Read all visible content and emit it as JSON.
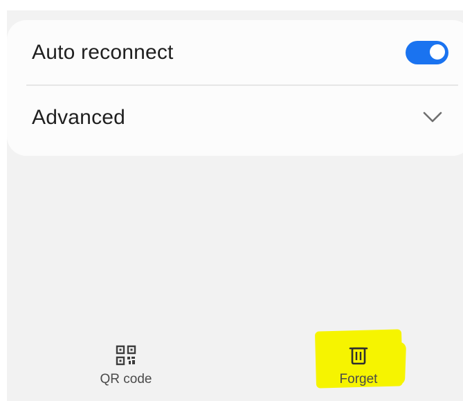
{
  "settings": {
    "auto_reconnect_label": "Auto reconnect",
    "auto_reconnect_enabled": true,
    "advanced_label": "Advanced"
  },
  "bottom_bar": {
    "qr_code_label": "QR code",
    "forget_label": "Forget"
  },
  "icons": {
    "qr": "qr-code-icon",
    "trash": "trash-icon",
    "chevron": "chevron-down-icon"
  },
  "colors": {
    "toggle_on": "#1a73f0",
    "highlight": "#f6f400",
    "background": "#f2f2f2",
    "card": "#fcfcfc"
  }
}
